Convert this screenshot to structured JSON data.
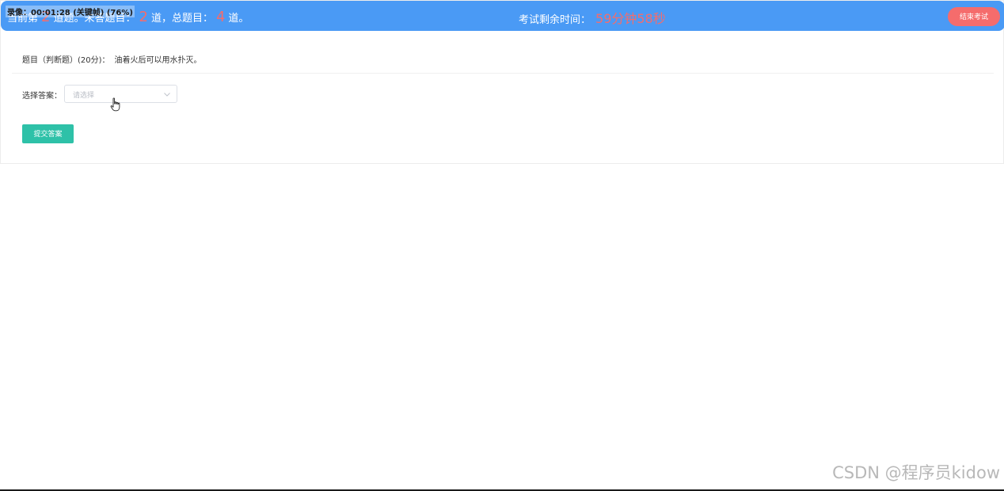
{
  "header": {
    "progress_prefix": "当前第",
    "current_num": "2",
    "progress_mid1": "道题。未答题目：",
    "unanswered_num": "2",
    "progress_mid2": "道，总题目：",
    "total_num": "4",
    "progress_suffix": "道。",
    "recording_overlay": "录像：00:01:28 (关键帧) (76%)",
    "timer_label": "考试剩余时间：",
    "timer_value": "59分钟58秒",
    "end_exam_label": "结束考试"
  },
  "question": {
    "meta": "题目（判断题）(20分)：",
    "text": "油着火后可以用水扑灭。"
  },
  "answer": {
    "label": "选择答案：",
    "placeholder": "请选择"
  },
  "submit_label": "提交答案",
  "watermark": "CSDN @程序员kidow",
  "colors": {
    "header_bg": "#4a9af5",
    "accent_red": "#f56c6c",
    "submit_bg": "#2ec1a8"
  },
  "icons": {
    "dropdown": "chevron-down-icon",
    "cursor": "hand-pointer-icon"
  }
}
